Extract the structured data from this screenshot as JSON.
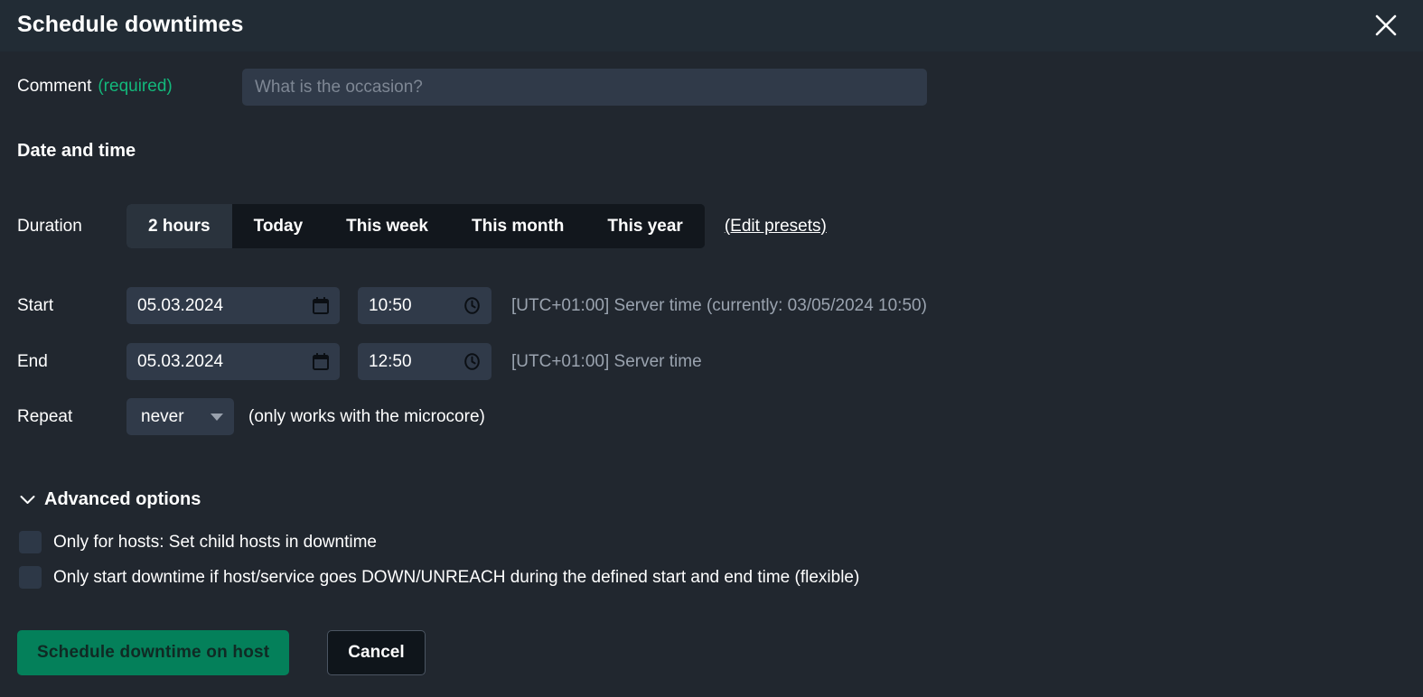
{
  "header": {
    "title": "Schedule downtimes",
    "close_icon": "close-icon"
  },
  "comment": {
    "label": "Comment",
    "required_text": "(required)",
    "value": "",
    "placeholder": "What is the occasion?"
  },
  "section": {
    "date_and_time": "Date and time"
  },
  "duration": {
    "label": "Duration",
    "presets": [
      {
        "label": "2 hours",
        "selected": true
      },
      {
        "label": "Today",
        "selected": false
      },
      {
        "label": "This week",
        "selected": false
      },
      {
        "label": "This month",
        "selected": false
      },
      {
        "label": "This year",
        "selected": false
      }
    ],
    "edit_presets_link": "(Edit presets)"
  },
  "start": {
    "label": "Start",
    "date": "05.03.2024",
    "time": "10:50",
    "timezone_note": "[UTC+01:00] Server time (currently: 03/05/2024 10:50)",
    "date_icon": "calendar-icon",
    "time_icon": "clock-icon"
  },
  "end": {
    "label": "End",
    "date": "05.03.2024",
    "time": "12:50",
    "timezone_note": "[UTC+01:00] Server time",
    "date_icon": "calendar-icon",
    "time_icon": "clock-icon"
  },
  "repeat": {
    "label": "Repeat",
    "value": "never",
    "options": [
      "never"
    ],
    "note": "(only works with the microcore)",
    "caret_icon": "chevron-down-icon"
  },
  "advanced": {
    "label": "Advanced options",
    "caret_icon": "chevron-down-icon",
    "checkboxes": [
      {
        "label": "Only for hosts: Set child hosts in downtime",
        "checked": false
      },
      {
        "label": "Only start downtime if host/service goes DOWN/UNREACH during the defined start and end time (flexible)",
        "checked": false
      }
    ]
  },
  "footer": {
    "submit_label": "Schedule downtime on host",
    "cancel_label": "Cancel"
  },
  "colors": {
    "background": "#21272f",
    "header_background": "#222c35",
    "input_background": "#303a49",
    "accent_green": "#04805a",
    "required_green": "#13b87b",
    "preset_group_background": "#12171d",
    "preset_selected_background": "#2a333d",
    "muted_text": "#9aa3af"
  }
}
